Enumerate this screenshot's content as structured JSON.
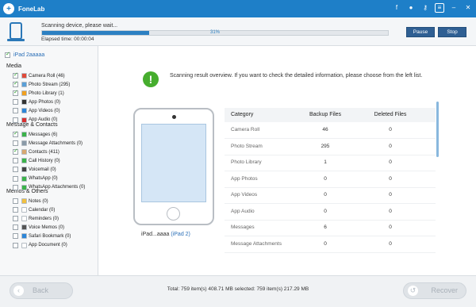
{
  "window": {
    "app_title": "FoneLab",
    "icons": [
      "facebook-icon",
      "chat-icon",
      "key-icon",
      "menu-icon",
      "minimize-icon",
      "close-icon"
    ]
  },
  "scan": {
    "status": "Scanning device, please wait...",
    "elapsed": "Elapsed time: 00:00:04",
    "progress_percent": 31,
    "progress_text": "31%",
    "pause_label": "Pause",
    "stop_label": "Stop"
  },
  "sidebar": {
    "device": "iPad 2aaaaa",
    "groups": [
      {
        "title": "Media",
        "items": [
          {
            "label": "Camera Roll (46)",
            "checked": true,
            "icon": "camera-roll-icon",
            "color": "#e04a3a"
          },
          {
            "label": "Photo Stream (295)",
            "checked": true,
            "icon": "photo-stream-icon",
            "color": "#5aa0d8"
          },
          {
            "label": "Photo Library (1)",
            "checked": true,
            "icon": "photo-library-icon",
            "color": "#f0a020"
          },
          {
            "label": "App Photos (0)",
            "checked": false,
            "icon": "app-photos-icon",
            "color": "#333333"
          },
          {
            "label": "App Videos (0)",
            "checked": false,
            "icon": "app-videos-icon",
            "color": "#2c86d8"
          },
          {
            "label": "App Audio (0)",
            "checked": false,
            "icon": "app-audio-icon",
            "color": "#d83030"
          }
        ]
      },
      {
        "title": "Message & Contacts",
        "items": [
          {
            "label": "Messages (6)",
            "checked": true,
            "icon": "messages-icon",
            "color": "#3bb34a"
          },
          {
            "label": "Message Attachments (0)",
            "checked": false,
            "icon": "attachments-icon",
            "color": "#8a9aa8"
          },
          {
            "label": "Contacts (411)",
            "checked": true,
            "icon": "contacts-icon",
            "color": "#d8a870"
          },
          {
            "label": "Call History (0)",
            "checked": false,
            "icon": "call-history-icon",
            "color": "#3bb34a"
          },
          {
            "label": "Voicemail (0)",
            "checked": false,
            "icon": "voicemail-icon",
            "color": "#444444"
          },
          {
            "label": "WhatsApp (0)",
            "checked": false,
            "icon": "whatsapp-icon",
            "color": "#3bb34a"
          },
          {
            "label": "WhatsApp Attachments (0)",
            "checked": false,
            "icon": "whatsapp-attachments-icon",
            "color": "#3bb34a"
          }
        ]
      },
      {
        "title": "Memos & Others",
        "items": [
          {
            "label": "Notes (0)",
            "checked": false,
            "icon": "notes-icon",
            "color": "#f0c040"
          },
          {
            "label": "Calendar (0)",
            "checked": false,
            "icon": "calendar-icon",
            "color": "#ffffff"
          },
          {
            "label": "Reminders (0)",
            "checked": false,
            "icon": "reminders-icon",
            "color": "#ffffff"
          },
          {
            "label": "Voice Memos (0)",
            "checked": false,
            "icon": "voice-memos-icon",
            "color": "#555555"
          },
          {
            "label": "Safari Bookmark (0)",
            "checked": false,
            "icon": "safari-icon",
            "color": "#2c86d8"
          },
          {
            "label": "App Document (0)",
            "checked": false,
            "icon": "app-document-icon",
            "color": "#ffffff"
          }
        ]
      }
    ]
  },
  "main": {
    "overview": "Scanning result overview. If you want to check the detailed information, please choose from the left list.",
    "device_label": "iPad...aaaa",
    "device_model": "(iPad 2)",
    "table": {
      "headers": [
        "Category",
        "Backup Files",
        "Deleted Files"
      ],
      "rows": [
        [
          "Camera Roll",
          "46",
          "0"
        ],
        [
          "Photo Stream",
          "295",
          "0"
        ],
        [
          "Photo Library",
          "1",
          "0"
        ],
        [
          "App Photos",
          "0",
          "0"
        ],
        [
          "App Videos",
          "0",
          "0"
        ],
        [
          "App Audio",
          "0",
          "0"
        ],
        [
          "Messages",
          "6",
          "0"
        ],
        [
          "Message Attachments",
          "0",
          "0"
        ]
      ]
    }
  },
  "bottom": {
    "back_label": "Back",
    "recover_label": "Recover",
    "totals": "Total:  759 item(s) 408.71 MB    selected: 759 item(s) 217.29 MB"
  },
  "colors": {
    "titlebar": "#1e7fc8",
    "accent": "#2c80c2",
    "info_green": "#46ad2e"
  }
}
